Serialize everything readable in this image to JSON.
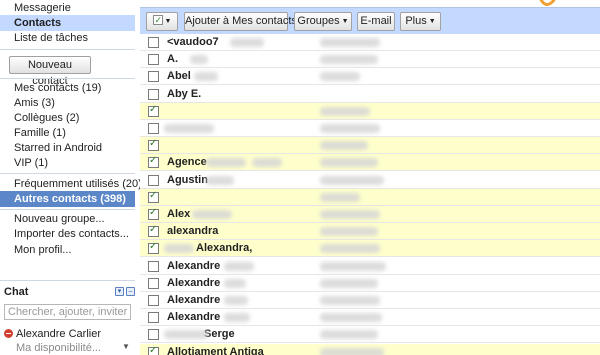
{
  "sidebar": {
    "top_links": [
      "Messagerie",
      "Contacts",
      "Liste de tâches"
    ],
    "new_contact_label": "Nouveau contact",
    "groups": [
      "Mes contacts (19)",
      "Amis (3)",
      "Collègues (2)",
      "Famille (1)",
      "Starred in Android",
      "VIP (1)"
    ],
    "frequent_label": "Fréquemment utilisés (20)",
    "other_contacts_label": "Autres contacts (398)",
    "actions": [
      "Nouveau groupe...",
      "Importer des contacts...",
      "Mon profil..."
    ]
  },
  "chat": {
    "title": "Chat",
    "search_placeholder": "Chercher, ajouter, inviter",
    "user_name": "Alexandre Carlier",
    "status_text": "Ma disponibilité...",
    "status_color": "#d23f31"
  },
  "toolbar": {
    "add_label": "Ajouter à Mes contacts",
    "groups_label": "Groupes",
    "email_label": "E-mail",
    "more_label": "Plus"
  },
  "accent": {
    "selected_bg": "#c3d9ff",
    "dark_selected_bg": "#5b87c8",
    "checked_row_bg": "#ffffcc"
  },
  "contacts": [
    {
      "name": "<vaudoo7",
      "checked": false
    },
    {
      "name": "A.",
      "checked": false
    },
    {
      "name": "Abel",
      "checked": false
    },
    {
      "name": "Aby E.",
      "checked": false
    },
    {
      "name": "",
      "checked": true
    },
    {
      "name": "",
      "checked": false
    },
    {
      "name": "",
      "checked": true
    },
    {
      "name": "Agence",
      "checked": true
    },
    {
      "name": "Agustin",
      "checked": false
    },
    {
      "name": "",
      "checked": true
    },
    {
      "name": "Alex",
      "checked": true
    },
    {
      "name": "alexandra",
      "checked": true
    },
    {
      "name": "Alexandra,",
      "checked": true
    },
    {
      "name": "Alexandre",
      "checked": false
    },
    {
      "name": "Alexandre",
      "checked": false
    },
    {
      "name": "Alexandre",
      "checked": false
    },
    {
      "name": "Alexandre",
      "checked": false
    },
    {
      "name": "Serge",
      "checked": false
    },
    {
      "name": "Allotjament Antiga",
      "checked": true
    }
  ]
}
